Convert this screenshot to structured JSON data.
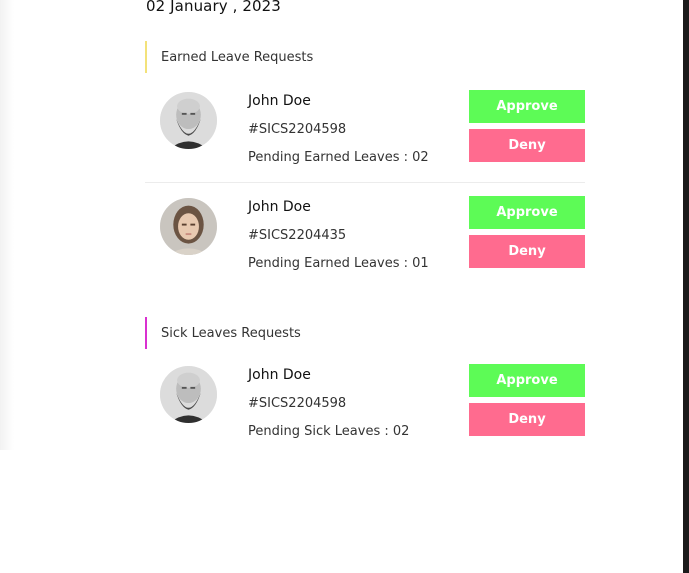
{
  "header": {
    "date": "02 January , 2023"
  },
  "colors": {
    "approve": "#5dfb56",
    "deny": "#ff6b8f",
    "earned_accent": "#f3e27a",
    "sick_accent": "#d930d0"
  },
  "earned": {
    "title": "Earned Leave Requests",
    "requests": [
      {
        "name": "John Doe",
        "id": "#SICS2204598",
        "pending": "Pending Earned Leaves : 02",
        "approve": "Approve",
        "deny": "Deny",
        "avatar": "bearded-man-avatar"
      },
      {
        "name": "John Doe",
        "id": "#SICS2204435",
        "pending": "Pending Earned Leaves : 01",
        "approve": "Approve",
        "deny": "Deny",
        "avatar": "woman-avatar"
      }
    ]
  },
  "sick": {
    "title": "Sick Leaves Requests",
    "requests": [
      {
        "name": "John Doe",
        "id": "#SICS2204598",
        "pending": "Pending Sick Leaves : 02",
        "approve": "Approve",
        "deny": "Deny",
        "avatar": "bearded-man-avatar"
      }
    ]
  }
}
